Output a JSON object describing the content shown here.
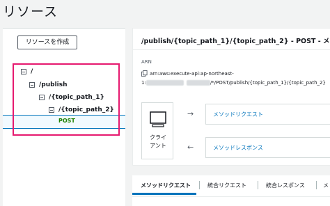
{
  "page": {
    "title": "リソース"
  },
  "sidebar": {
    "create_button": "リソースを作成",
    "tree": [
      {
        "label": "/"
      },
      {
        "label": "/publish"
      },
      {
        "label": "/{topic_path_1}"
      },
      {
        "label": "/{topic_path_2}"
      }
    ],
    "method": "POST"
  },
  "detail": {
    "title": "/publish/{topic_path_1}/{topic_path_2} - POST - メソ",
    "arn_label": "ARN",
    "arn_line1": "arn:aws:execute-api:ap-northeast-",
    "arn_line2_prefix": "1:",
    "arn_line2_suffix": "/*/POST/publish/{topic_path_1}/{topic_path_2}",
    "client_label": "クライ\nアント",
    "method_request": "メソッドリクエスト",
    "method_response": "メソッドレスポンス"
  },
  "tabs": [
    {
      "label": "メソッドリクエスト",
      "active": true
    },
    {
      "label": "統合リクエスト"
    },
    {
      "label": "統合レスポンス"
    },
    {
      "label": "メ"
    }
  ],
  "colors": {
    "accent": "#0073bb",
    "highlight": "#e6196f",
    "method": "#1d8102"
  }
}
